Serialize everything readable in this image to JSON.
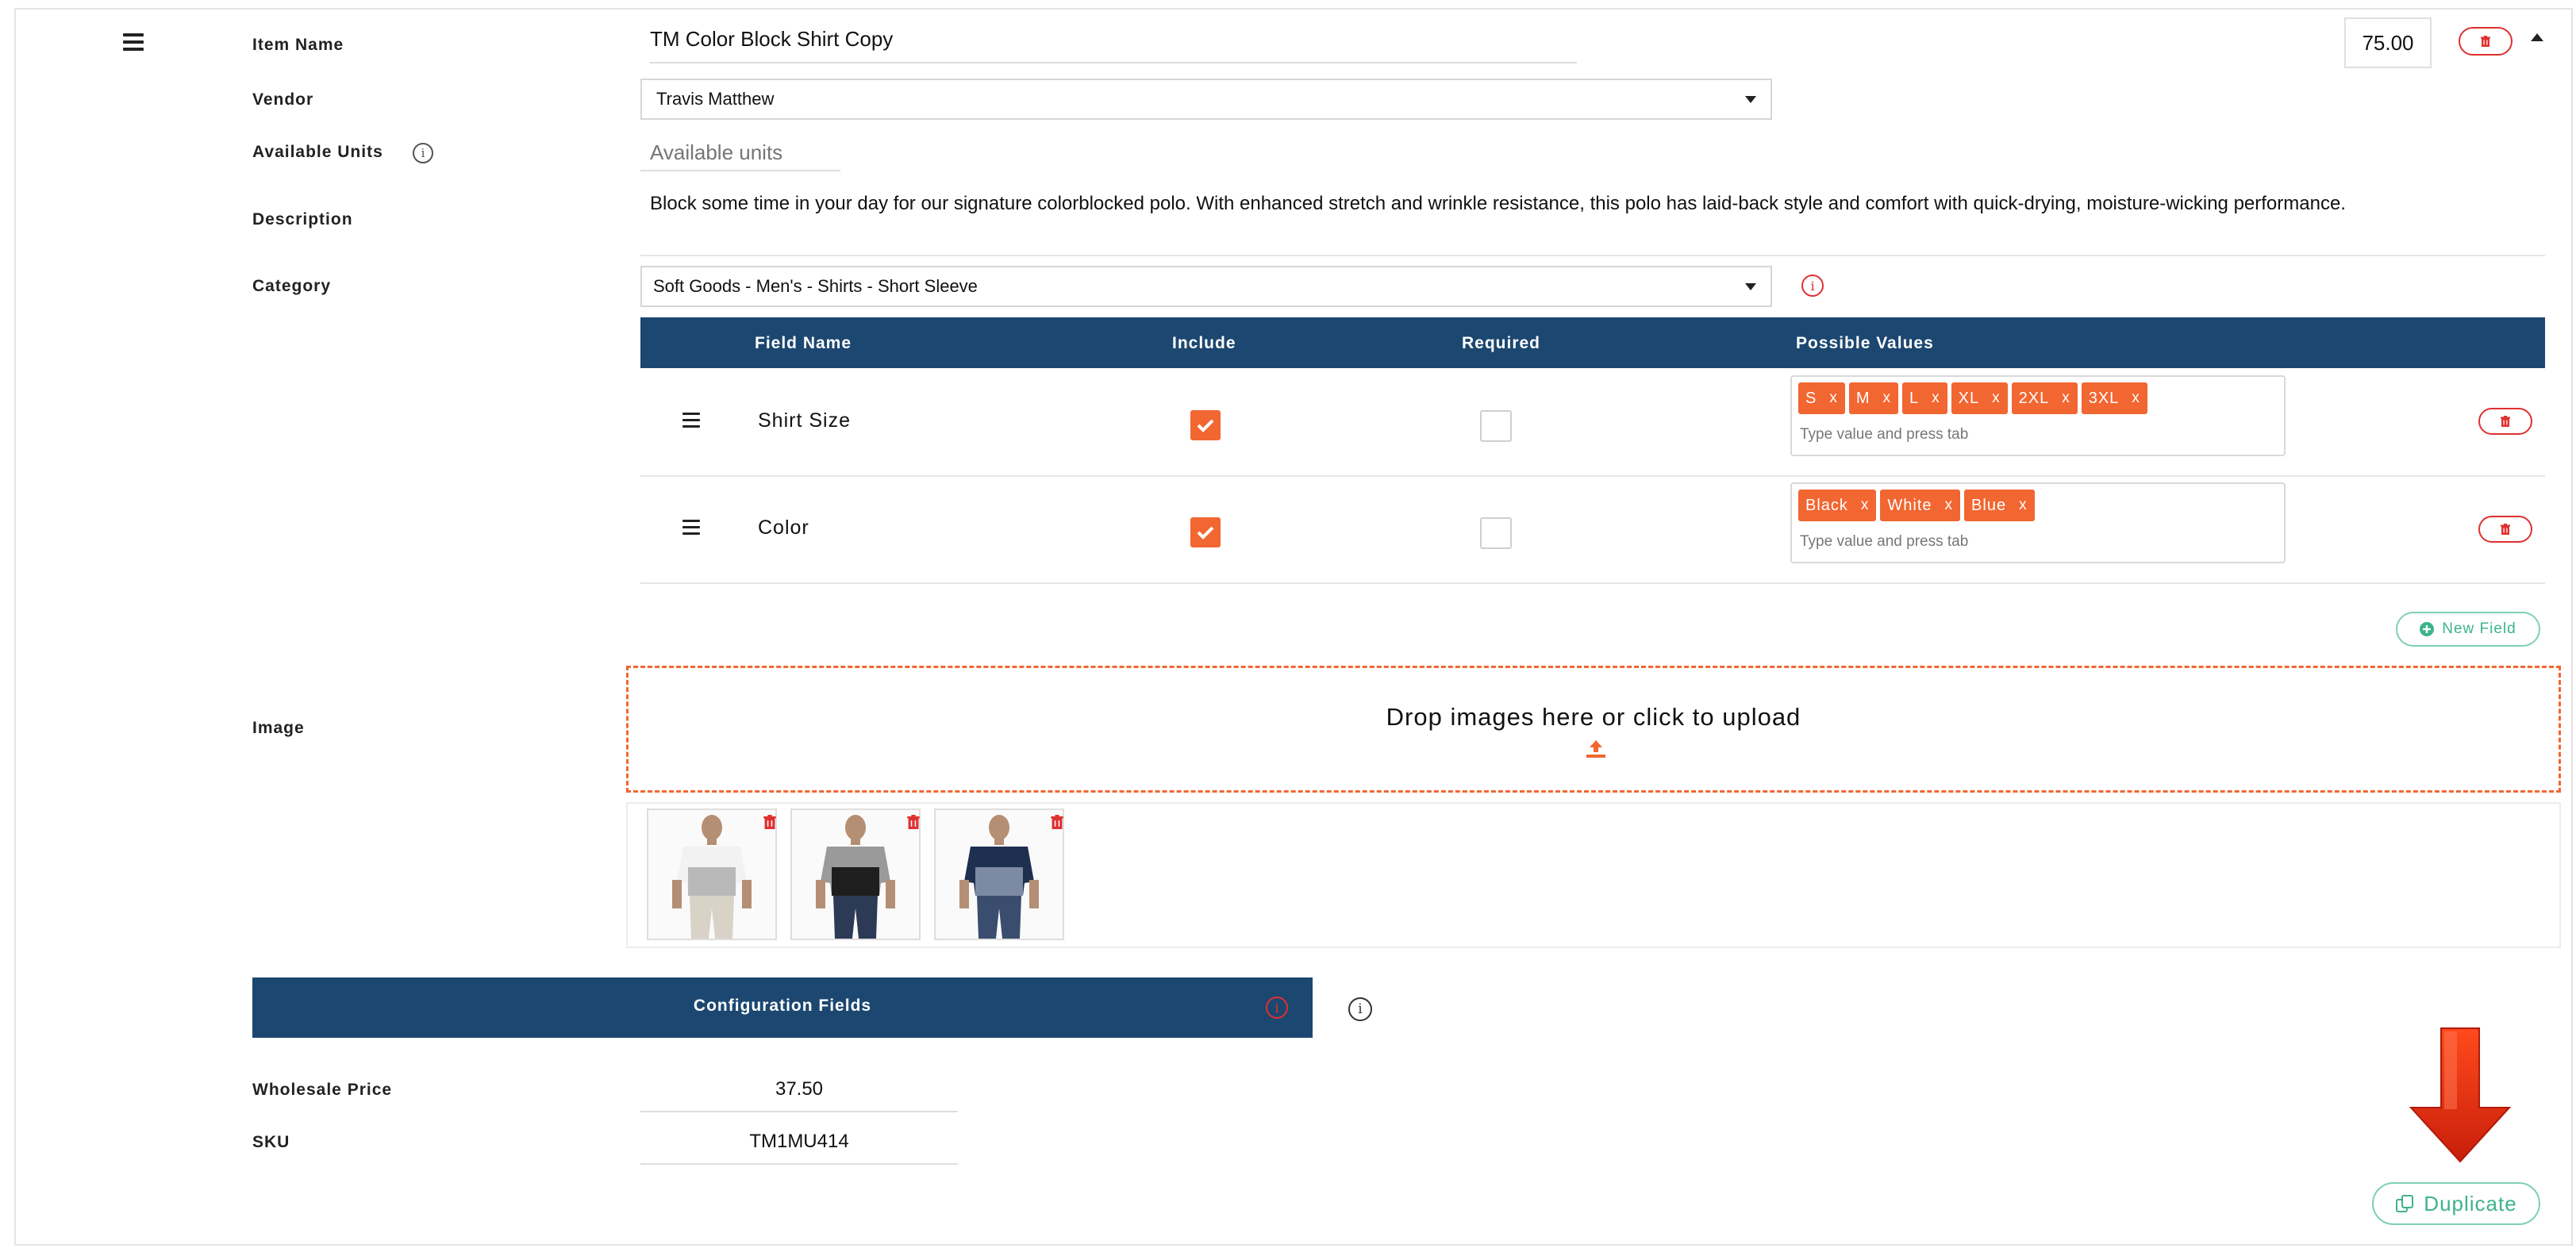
{
  "item": {
    "name_label": "Item Name",
    "name_value": "TM Color Block Shirt Copy",
    "price_value": "75.00"
  },
  "vendor": {
    "label": "Vendor",
    "selected": "Travis Matthew"
  },
  "units": {
    "label": "Available Units",
    "placeholder": "Available units"
  },
  "description": {
    "label": "Description",
    "value": "Block some time in your day for our signature colorblocked polo. With enhanced stretch and wrinkle resistance, this polo has laid-back style and comfort with quick-drying, moisture-wicking performance."
  },
  "category": {
    "label": "Category",
    "selected": "Soft Goods - Men's - Shirts - Short Sleeve"
  },
  "fields_table": {
    "headers": {
      "field_name": "Field Name",
      "include": "Include",
      "required": "Required",
      "possible_values": "Possible Values"
    },
    "rows": [
      {
        "name": "Shirt Size",
        "include": true,
        "required": false,
        "values": [
          "S",
          "M",
          "L",
          "XL",
          "2XL",
          "3XL"
        ],
        "placeholder": "Type value and press tab"
      },
      {
        "name": "Color",
        "include": true,
        "required": false,
        "values": [
          "Black",
          "White",
          "Blue"
        ],
        "placeholder": "Type value and press tab"
      }
    ],
    "new_field_label": "New Field"
  },
  "image": {
    "label": "Image",
    "dropzone_text": "Drop images here or click to upload",
    "thumbnail_count": 3
  },
  "config": {
    "bar_label": "Configuration Fields",
    "wholesale_label": "Wholesale Price",
    "wholesale_value": "37.50",
    "sku_label": "SKU",
    "sku_value": "TM1MU414"
  },
  "actions": {
    "duplicate_label": "Duplicate"
  },
  "colors": {
    "accent": "#f26631",
    "navy": "#1c4770",
    "danger": "#e03030",
    "green": "#3db38a"
  },
  "icons": [
    "hamburger-icon",
    "trash-icon",
    "caret-up-icon",
    "chevron-down-icon",
    "info-icon",
    "plus-circle-icon",
    "upload-icon",
    "check-icon",
    "copy-icon",
    "arrow-down-icon"
  ]
}
